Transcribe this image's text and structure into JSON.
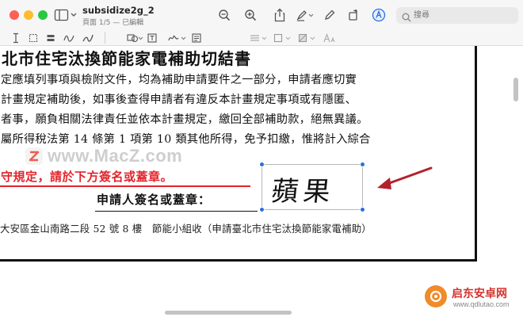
{
  "window": {
    "title": "subsidize2g_2",
    "subtitle": "頁面 1/5 — 已編輯"
  },
  "search": {
    "placeholder": "搜尋"
  },
  "document": {
    "heading": "北市住宅汰換節能家電補助切結書",
    "lines": [
      "定應填列事項與檢附文件，均為補助申請要件之一部分，申請者應切實",
      "計畫規定補助後，如事後查得申請者有違反本計畫規定事項或有隱匿、",
      "者事，願負相關法律責任並依本計畫規定，繳回全部補助款，絕無異議。",
      "屬所得稅法第 14 條第 1 項第 10 類其他所得，免予扣繳，惟將計入綜合"
    ],
    "red_notice": "守規定，請於下方簽名或蓋章。",
    "sign_label": "申請人簽名或蓋章：",
    "signature": "蘋果",
    "footer": "大安區金山南路二段 52 號 8 樓　節能小組收（申請臺北市住宅汰換節能家電補助）"
  },
  "watermark": {
    "text": "www.MacZ.com"
  },
  "corner_logo": {
    "name": "启东安卓网",
    "url": "www.qdlutao.com"
  },
  "colors": {
    "accent": "#2a6fdc",
    "notice_red": "#e3242b",
    "arrow_red": "#b3222a"
  }
}
